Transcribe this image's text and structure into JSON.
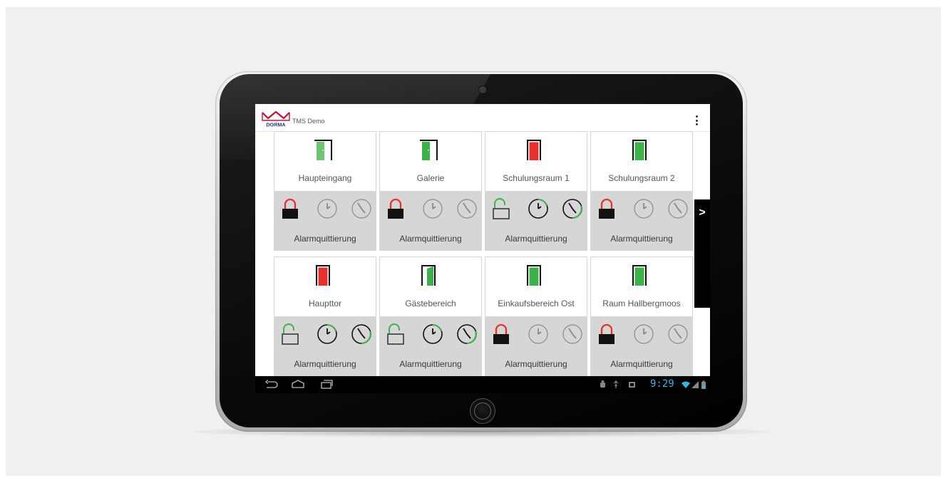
{
  "colors": {
    "green": "#3cb34a",
    "red": "#e8302e",
    "light_green": "#6dc571",
    "gray_icon": "#8a8a8a",
    "dark": "#111111",
    "clock_text": "#33b5e5"
  },
  "app": {
    "logo_text": "DORMA",
    "title": "TMS Demo",
    "menu_icon": "overflow-menu-icon"
  },
  "pager": {
    "next_label": ">"
  },
  "doors": [
    {
      "name": "Haupteingang",
      "door_state": "open",
      "door_color": "light_green",
      "lock": "locked-red",
      "clocks": "gray",
      "action": "Alarmquittierung"
    },
    {
      "name": "Galerie",
      "door_state": "open",
      "door_color": "green",
      "lock": "locked-red",
      "clocks": "gray",
      "action": "Alarmquittierung"
    },
    {
      "name": "Schulungsraum 1",
      "door_state": "closed",
      "door_color": "red",
      "lock": "unlocked-green",
      "clocks": "active",
      "action": "Alarmquittierung"
    },
    {
      "name": "Schulungsraum 2",
      "door_state": "closed",
      "door_color": "green",
      "lock": "locked-red",
      "clocks": "gray",
      "action": "Alarmquittierung"
    },
    {
      "name": "Haupttor",
      "door_state": "closed",
      "door_color": "red",
      "lock": "unlocked-green",
      "clocks": "active",
      "action": "Alarmquittierung"
    },
    {
      "name": "Gästebereich",
      "door_state": "ajar",
      "door_color": "green",
      "lock": "unlocked-green",
      "clocks": "active",
      "action": "Alarmquittierung"
    },
    {
      "name": "Einkaufsbereich Ost",
      "door_state": "closed",
      "door_color": "green",
      "lock": "locked-red",
      "clocks": "gray",
      "action": "Alarmquittierung"
    },
    {
      "name": "Raum Hallbergmoos",
      "door_state": "closed",
      "door_color": "green",
      "lock": "locked-red",
      "clocks": "gray",
      "action": "Alarmquittierung"
    }
  ],
  "navbar": {
    "buttons": [
      "back-icon",
      "home-icon",
      "recent-apps-icon"
    ],
    "status_icons": [
      "android-icon",
      "usb-icon",
      "screenshot-icon",
      "wifi-icon",
      "signal-icon",
      "battery-icon"
    ],
    "time": "9:29"
  }
}
